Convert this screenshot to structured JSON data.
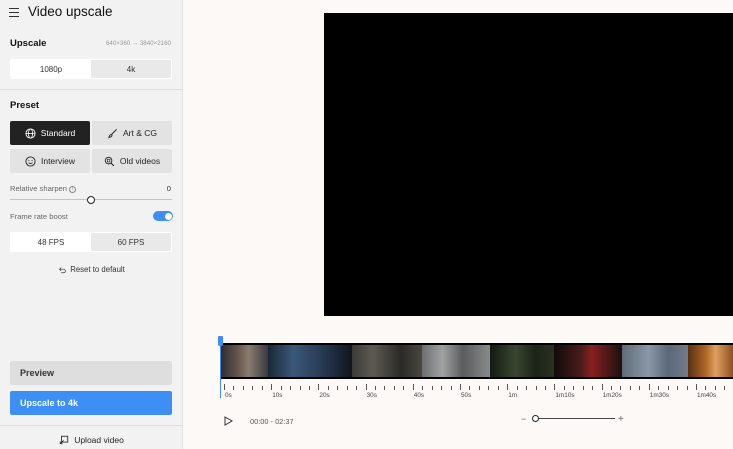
{
  "app": {
    "title": "Video upscale",
    "menu_icon": "hamburger-menu-icon"
  },
  "upscale": {
    "title": "Upscale",
    "resolution": "640×360 → 3840×2160",
    "options": [
      "1080p",
      "4k"
    ],
    "selected": "4k"
  },
  "preset": {
    "title": "Preset",
    "buttons": [
      {
        "label": "Standard",
        "icon": "globe-icon",
        "selected": true
      },
      {
        "label": "Art & CG",
        "icon": "brush-icon",
        "selected": false
      },
      {
        "label": "Interview",
        "icon": "smile-icon",
        "selected": false
      },
      {
        "label": "Old videos",
        "icon": "search-film-icon",
        "selected": false
      }
    ]
  },
  "sharpen": {
    "label": "Relative sharpen",
    "value": "0",
    "level": 0.5
  },
  "frame_rate": {
    "label": "Frame rate boost",
    "enabled": true,
    "options": [
      "48 FPS",
      "60 FPS"
    ],
    "selected": "60 FPS"
  },
  "reset_label": "Reset to default",
  "actions": {
    "preview": "Preview",
    "upscale": "Upscale to 4k"
  },
  "upload_label": "Upload video",
  "player": {
    "time": "00:00 - 02:37",
    "ruler_labels": [
      "0s",
      "10s",
      "20s",
      "30s",
      "40s",
      "50s",
      "1m",
      "1m10s",
      "1m20s",
      "1m30s",
      "1m40s"
    ],
    "zoom_level": 0.0
  },
  "colors": {
    "accent": "#3d8ff5",
    "selected_dark": "#222222",
    "sidebar_bg": "#f2f2f2"
  }
}
